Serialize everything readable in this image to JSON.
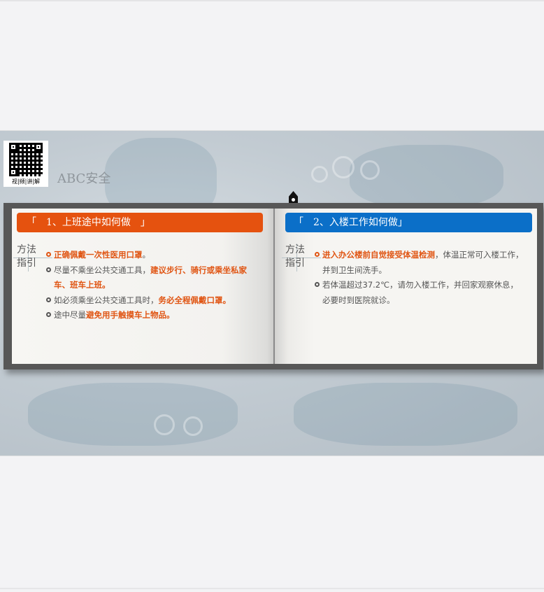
{
  "logo": {
    "caption": "视|频|讲|解",
    "text": "ABC安全"
  },
  "colors": {
    "orange": "#e5520f",
    "blue": "#0b6fc8",
    "highlight": "#e05513",
    "book": "#575757"
  },
  "left_page": {
    "header": "「　1、上班途中如何做　」",
    "method_label_1": "方法",
    "method_label_2": "指引",
    "items": [
      {
        "highlight": "正确佩戴一次性医用口罩",
        "tail": "。"
      },
      {
        "pre": "尽量不乘坐公共交通工具，",
        "highlight": "建议步行、骑行或乘坐私家",
        "highlight2": "车、班车上班",
        "tail": "。"
      },
      {
        "pre": "如必须乘坐公共交通工具时，",
        "highlight": "务必全程佩戴口罩",
        "tail": "。"
      },
      {
        "pre": "途中尽量",
        "highlight": "避免用手触摸车上物品",
        "tail": "。"
      }
    ]
  },
  "right_page": {
    "header": "「　2、入楼工作如何做」",
    "method_label_1": "方法",
    "method_label_2": "指引",
    "items": [
      {
        "highlight": "进入办公楼前自觉接受体温检测",
        "post": "，体温正常可入楼工作，",
        "post2": "并到卫生间洗手。"
      },
      {
        "pre": "若体温超过37.2℃，请勿入楼工作，并回家观察休息，",
        "pre2": "必要时到医院就诊。"
      }
    ]
  }
}
